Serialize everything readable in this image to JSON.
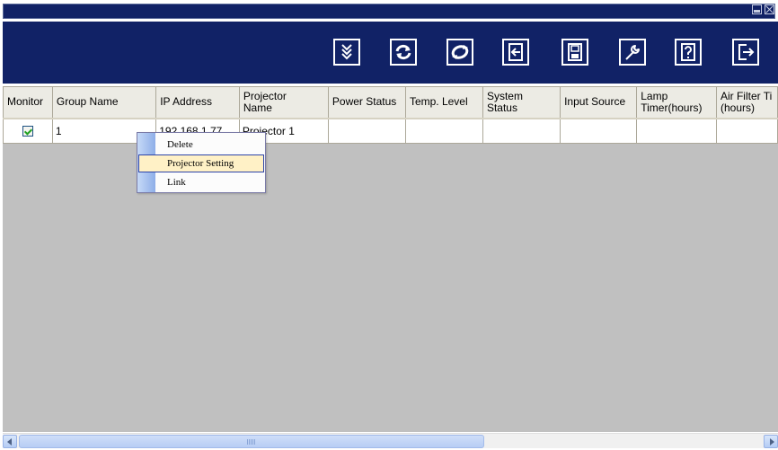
{
  "window": {
    "controls": [
      "minimize-icon",
      "close-icon"
    ]
  },
  "toolbar": {
    "buttons": [
      {
        "name": "search-button",
        "icon": "search-down-arrows-icon"
      },
      {
        "name": "refresh-button",
        "icon": "refresh-icon"
      },
      {
        "name": "sync-button",
        "icon": "sync-icon"
      },
      {
        "name": "import-button",
        "icon": "import-icon"
      },
      {
        "name": "save-button",
        "icon": "save-icon"
      },
      {
        "name": "settings-button",
        "icon": "wrench-icon"
      },
      {
        "name": "help-button",
        "icon": "help-icon"
      },
      {
        "name": "exit-button",
        "icon": "exit-icon"
      }
    ],
    "colors": {
      "background": "#112266",
      "icon": "#ffffff"
    }
  },
  "table": {
    "columns": [
      "Monitor",
      "Group Name",
      "IP Address",
      "Projector Name",
      "Power Status",
      "Temp. Level",
      "System Status",
      "Input Source",
      "Lamp Timer(hours)",
      "Air Filter Ti (hours)"
    ],
    "column_lines": [
      [
        "Monitor"
      ],
      [
        "Group Name"
      ],
      [
        "IP Address"
      ],
      [
        "Projector",
        "Name"
      ],
      [
        "Power Status"
      ],
      [
        "Temp. Level"
      ],
      [
        "System",
        "Status"
      ],
      [
        "Input Source"
      ],
      [
        "Lamp",
        "Timer(hours)"
      ],
      [
        "Air Filter Ti",
        "(hours)"
      ]
    ],
    "rows": [
      {
        "monitor": true,
        "group_name": "1",
        "ip_address": "192.168.1.77",
        "projector_name": "Projector 1",
        "power_status": "",
        "temp_level": "",
        "system_status": "",
        "input_source": "",
        "lamp_timer": "",
        "air_filter": ""
      }
    ]
  },
  "context_menu": {
    "items": [
      "Delete",
      "Projector Setting",
      "Link"
    ],
    "highlighted": "Projector Setting"
  },
  "scrollbar": {
    "position": 0
  }
}
